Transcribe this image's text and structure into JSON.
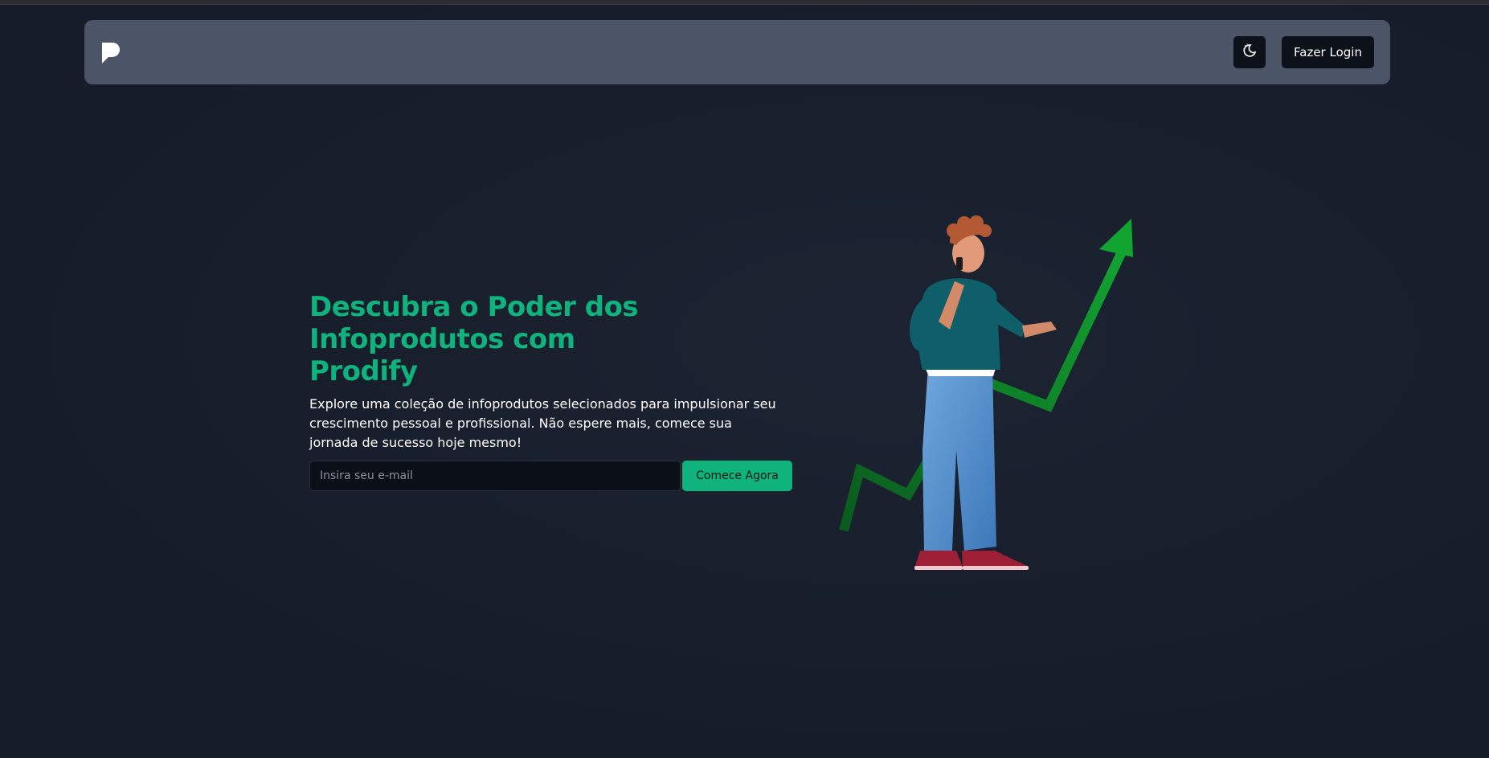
{
  "header": {
    "logo_icon": "prodify-logo-icon",
    "theme_toggle_icon": "moon-icon",
    "login_label": "Fazer Login"
  },
  "hero": {
    "title_line1": "Descubra o Poder dos",
    "title_line2": "Infoprodutos com",
    "title_line3": "Prodify",
    "description": "Explore uma coleção de infoprodutos selecionados para impulsionar seu crescimento pessoal e profissional. Não espere mais, comece sua jornada de sucesso hoje mesmo!",
    "email_placeholder": "Insira seu e-mail",
    "cta_label": "Comece Agora",
    "illustration_icon": "growth-chart-person-illustration"
  },
  "colors": {
    "background": "#181e2c",
    "navbar": "#4b5567",
    "accent": "#10b37c",
    "button_dark": "#0d1119"
  }
}
